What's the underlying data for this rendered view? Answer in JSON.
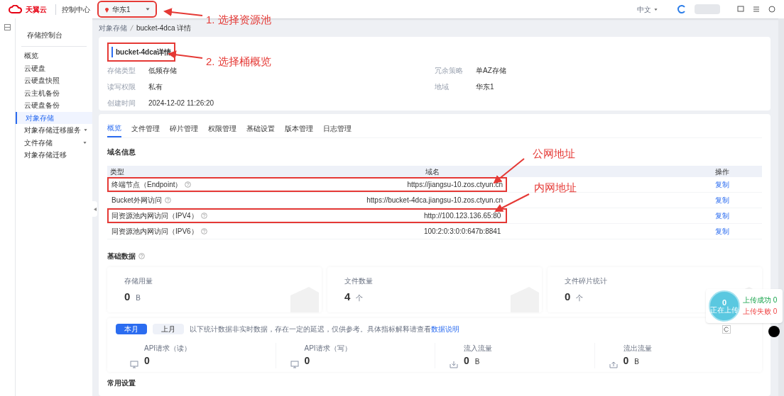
{
  "header": {
    "logo": "天翼云",
    "nav": "控制中心",
    "region": {
      "value": "华东1",
      "highlighted": true
    },
    "language": "中文"
  },
  "sidebar": {
    "title": "存储控制台",
    "items": [
      {
        "label": "概览",
        "selected": false,
        "expandable": false
      },
      {
        "label": "云硬盘",
        "selected": false,
        "expandable": false
      },
      {
        "label": "云硬盘快照",
        "selected": false,
        "expandable": false
      },
      {
        "label": "云主机备份",
        "selected": false,
        "expandable": false
      },
      {
        "label": "云硬盘备份",
        "selected": false,
        "expandable": false
      },
      {
        "label": "对象存储",
        "selected": true,
        "expandable": false
      },
      {
        "label": "对象存储迁移服务",
        "selected": false,
        "expandable": true
      },
      {
        "label": "文件存储",
        "selected": false,
        "expandable": true
      },
      {
        "label": "对象存储迁移",
        "selected": false,
        "expandable": false
      }
    ]
  },
  "breadcrumb": [
    "对象存储",
    "bucket-4dca 详情"
  ],
  "detail": {
    "title": "bucket-4dca详情",
    "highlighted": true,
    "fields": [
      {
        "label": "存储类型",
        "value": "低频存储"
      },
      {
        "label": "冗余策略",
        "value": "单AZ存储"
      },
      {
        "label": "读写权限",
        "value": "私有"
      },
      {
        "label": "地域",
        "value": "华东1"
      },
      {
        "label": "创建时间",
        "value": "2024-12-02 11:26:20"
      }
    ]
  },
  "tabs": [
    {
      "label": "概览",
      "selected": true
    },
    {
      "label": "文件管理",
      "selected": false
    },
    {
      "label": "碎片管理",
      "selected": false
    },
    {
      "label": "权限管理",
      "selected": false
    },
    {
      "label": "基础设置",
      "selected": false
    },
    {
      "label": "版本管理",
      "selected": false
    },
    {
      "label": "日志管理",
      "selected": false
    }
  ],
  "domain_info": {
    "title": "域名信息",
    "columns": [
      "类型",
      "域名",
      "操作"
    ],
    "rows": [
      {
        "type": "终端节点（Endpoint）",
        "domain": "https://jiangsu-10.zos.ctyun.cn",
        "action": "复制",
        "highlighted": true
      },
      {
        "type": "Bucket外网访问",
        "domain": "https://bucket-4dca.jiangsu-10.zos.ctyun.cn",
        "action": "复制",
        "highlighted": false
      },
      {
        "type": "同资源池内网访问（IPV4）",
        "domain": "http://100.123.136.65:80",
        "action": "复制",
        "highlighted": true
      },
      {
        "type": "同资源池内网访问（IPV6）",
        "domain": "100:2:0:3:0:0:647b:8841",
        "action": "复制",
        "highlighted": false
      }
    ]
  },
  "basic_data": {
    "title": "基础数据",
    "cards": [
      {
        "label": "存储用量",
        "value": "0",
        "unit": "B"
      },
      {
        "label": "文件数量",
        "value": "4",
        "unit": "个"
      },
      {
        "label": "文件碎片统计",
        "value": "0",
        "unit": "个"
      }
    ]
  },
  "period": {
    "buttons": [
      {
        "label": "本月",
        "selected": true
      },
      {
        "label": "上月",
        "selected": false
      }
    ],
    "note": "以下统计数据非实时数据，存在一定的延迟，仅供参考。具体指标解释请查看",
    "link": "数据说明"
  },
  "metrics": [
    {
      "label": "API请求（读）",
      "value": "0",
      "kind": "api"
    },
    {
      "label": "API请求（写）",
      "value": "0",
      "kind": "api"
    },
    {
      "label": "流入流量",
      "value": "0",
      "unit": "B",
      "kind": "in"
    },
    {
      "label": "流出流量",
      "value": "0",
      "unit": "B",
      "kind": "out"
    }
  ],
  "common_settings": {
    "title": "常用设置"
  },
  "upload_widget": {
    "count": "0",
    "status": "正在上传",
    "success": "上传成功 0",
    "failed": "上传失败 0"
  },
  "annotations": [
    "1. 选择资源池",
    "2. 选择桶概览",
    "公网地址",
    "内网地址"
  ]
}
